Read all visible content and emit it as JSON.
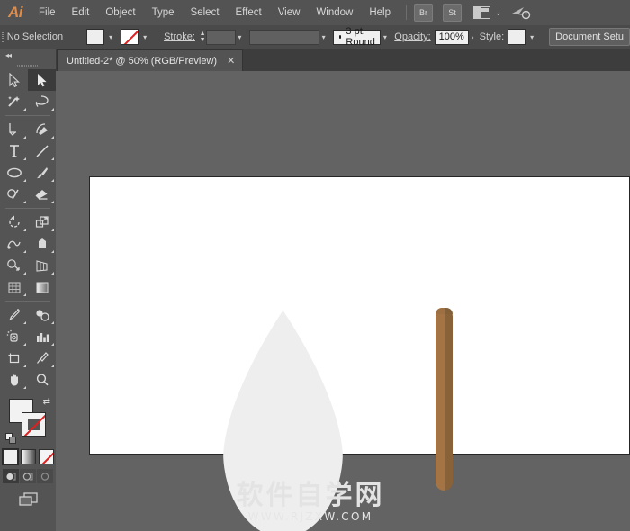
{
  "app": {
    "name": "Adobe Illustrator",
    "logo_text": "Ai"
  },
  "menubar": {
    "items": [
      {
        "label": "File"
      },
      {
        "label": "Edit"
      },
      {
        "label": "Object"
      },
      {
        "label": "Type"
      },
      {
        "label": "Select"
      },
      {
        "label": "Effect"
      },
      {
        "label": "View"
      },
      {
        "label": "Window"
      },
      {
        "label": "Help"
      }
    ],
    "bridge_label": "Br",
    "stock_label": "St",
    "workspace_icon": "workspace-layout-icon",
    "workspace_chevron": "⌄",
    "search_icon": "search-help-icon"
  },
  "controlbar": {
    "selection_status": "No Selection",
    "fill_swatch": "white-fill-swatch",
    "fill_color": "#eeeeee",
    "stroke_swatch": "none-stroke-swatch",
    "stroke_label": "Stroke:",
    "stroke_weight": "",
    "variable_width_profile": "",
    "brush_definition": "3 pt. Round",
    "opacity_label": "Opacity:",
    "opacity_value": "100%",
    "opacity_arrow": "›",
    "style_label": "Style:",
    "style_swatch": "graphic-style-swatch",
    "document_setup": "Document Setu"
  },
  "tabbar": {
    "tabs": [
      {
        "title": "Untitled-2* @ 50% (RGB/Preview)",
        "close": "✕",
        "active": true
      }
    ]
  },
  "toolbar": {
    "collapse_icon": "«",
    "tools": [
      {
        "name": "selection-tool",
        "active": false
      },
      {
        "name": "direct-selection-tool",
        "active": true
      },
      {
        "name": "magic-wand-tool",
        "active": false
      },
      {
        "name": "lasso-tool",
        "active": false
      },
      {
        "name": "pen-tool",
        "active": false
      },
      {
        "name": "curvature-tool",
        "active": false
      },
      {
        "name": "type-tool",
        "active": false
      },
      {
        "name": "line-segment-tool",
        "active": false
      },
      {
        "name": "ellipse-tool",
        "active": false
      },
      {
        "name": "paintbrush-tool",
        "active": false
      },
      {
        "name": "shaper-pencil-tool",
        "active": false
      },
      {
        "name": "eraser-tool",
        "active": false
      },
      {
        "name": "rotate-tool",
        "active": false
      },
      {
        "name": "scale-tool",
        "active": false
      },
      {
        "name": "width-warp-tool",
        "active": false
      },
      {
        "name": "free-transform-tool",
        "active": false
      },
      {
        "name": "shape-builder-tool",
        "active": false
      },
      {
        "name": "perspective-grid-tool",
        "active": false
      },
      {
        "name": "mesh-tool",
        "active": false
      },
      {
        "name": "gradient-tool",
        "active": false
      },
      {
        "name": "eyedropper-tool",
        "active": false
      },
      {
        "name": "blend-tool",
        "active": false
      },
      {
        "name": "symbol-sprayer-tool",
        "active": false
      },
      {
        "name": "column-graph-tool",
        "active": false
      },
      {
        "name": "artboard-tool",
        "active": false
      },
      {
        "name": "slice-tool",
        "active": false
      },
      {
        "name": "hand-tool",
        "active": false
      },
      {
        "name": "zoom-tool",
        "active": false
      }
    ],
    "fill_color": "#f2f2f2",
    "stroke_color": "none",
    "swap_icon": "⇄",
    "color_mode": "color-fill-button",
    "gradient_mode": "gradient-fill-button",
    "none_mode": "none-fill-button",
    "draw_normal": "draw-normal-mode",
    "draw_behind": "draw-behind-mode",
    "draw_inside": "draw-inside-mode",
    "screen_mode": "change-screen-mode"
  },
  "canvas": {
    "background_color": "#636363",
    "artboard_color": "#ffffff",
    "zoom_level": "50%",
    "shapes": [
      {
        "name": "leaf-shape",
        "fill": "#eeeeee",
        "description": "pointed teardrop leaf"
      },
      {
        "name": "stick-shape",
        "fill_light": "#a57444",
        "fill_dark": "#8a6239",
        "description": "rounded brown stick"
      }
    ],
    "watermark": {
      "chinese": "软件自学网",
      "url": "WWW.RJZXW.COM"
    }
  }
}
